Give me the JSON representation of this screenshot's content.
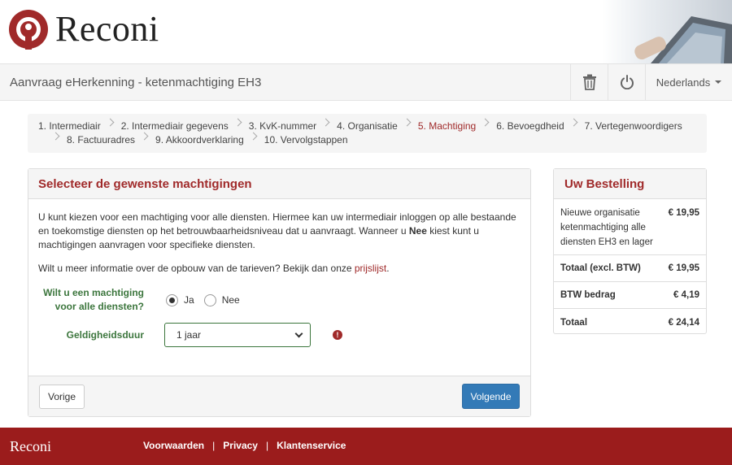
{
  "brand": {
    "name": "Reconi",
    "color": "#a02a2a"
  },
  "subbar": {
    "title": "Aanvraag eHerkenning - ketenmachtiging EH3",
    "language": "Nederlands"
  },
  "steps": [
    {
      "label": "1. Intermediair",
      "active": false
    },
    {
      "label": "2. Intermediair gegevens",
      "active": false
    },
    {
      "label": "3. KvK-nummer",
      "active": false
    },
    {
      "label": "4. Organisatie",
      "active": false
    },
    {
      "label": "5. Machtiging",
      "active": true
    },
    {
      "label": "6. Bevoegdheid",
      "active": false
    },
    {
      "label": "7. Vertegenwoordigers",
      "active": false
    },
    {
      "label": "8. Factuuradres",
      "active": false
    },
    {
      "label": "9. Akkoordverklaring",
      "active": false
    },
    {
      "label": "10. Vervolgstappen",
      "active": false
    }
  ],
  "panel": {
    "title": "Selecteer de gewenste machtigingen",
    "intro_a": "U kunt kiezen voor een machtiging voor alle diensten. Hiermee kan uw intermediair inloggen op alle bestaande en toekomstige diensten op het betrouwbaarheidsniveau dat u aanvraagt. Wanneer u ",
    "intro_bold": "Nee",
    "intro_b": " kiest kunt u machtigingen aanvragen voor specifieke diensten.",
    "info_text": "Wilt u meer informatie over de opbouw van de tarieven? Bekijk dan onze ",
    "info_link": "prijslijst",
    "info_end": ".",
    "question_label": "Wilt u een machtiging voor alle diensten?",
    "option_yes": "Ja",
    "option_no": "Nee",
    "selected_option": "Ja",
    "duration_label": "Geldigheidsduur",
    "duration_value": "1 jaar",
    "prev_label": "Vorige",
    "next_label": "Volgende"
  },
  "order": {
    "title": "Uw Bestelling",
    "item_desc": "Nieuwe organisatie ketenmachtiging alle diensten EH3 en lager",
    "item_amount": "€ 19,95",
    "subtotal_label": "Totaal (excl. BTW)",
    "subtotal_amount": "€ 19,95",
    "vat_label": "BTW bedrag",
    "vat_amount": "€ 4,19",
    "total_label": "Totaal",
    "total_amount": "€ 24,14"
  },
  "footer": {
    "brand": "Reconi",
    "links": [
      "Voorwaarden",
      "Privacy",
      "Klantenservice"
    ],
    "separator": "|",
    "background": "#9b1c1c"
  },
  "icons": {
    "delete": "trash-icon",
    "logout": "power-icon",
    "info": "info-icon"
  }
}
